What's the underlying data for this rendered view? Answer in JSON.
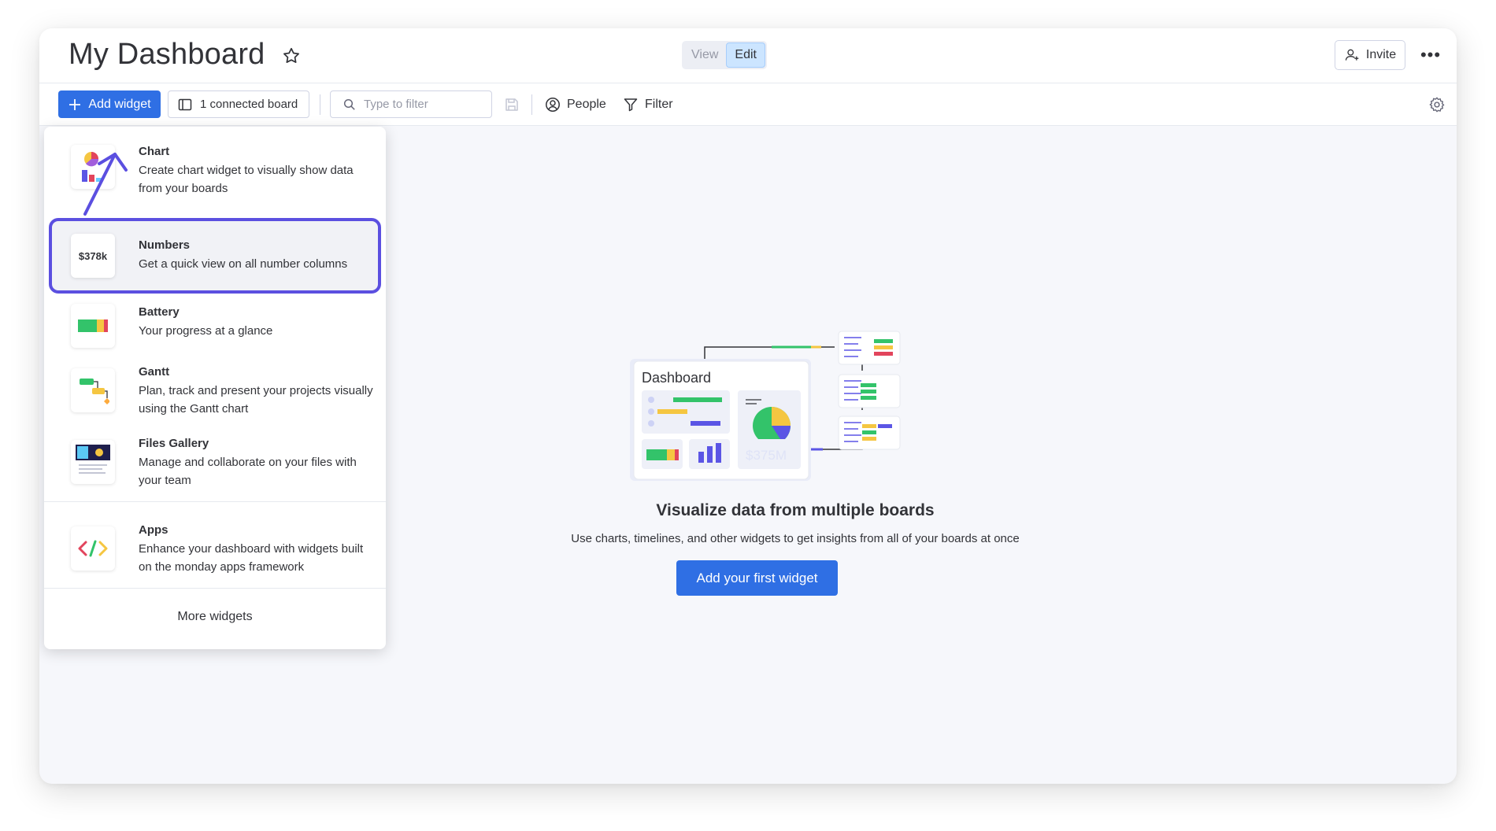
{
  "header": {
    "title": "My Dashboard",
    "mode": {
      "view_label": "View",
      "edit_label": "Edit",
      "active": "Edit"
    },
    "invite_label": "Invite",
    "more_label": "•••"
  },
  "toolbar": {
    "add_widget_label": "Add widget",
    "connected_label": "1 connected board",
    "search_placeholder": "Type to filter",
    "people_label": "People",
    "filter_label": "Filter"
  },
  "dropdown": {
    "items": [
      {
        "name": "Chart",
        "desc": "Create chart widget to visually show data from your boards",
        "icon": "chart-icon"
      },
      {
        "name": "Numbers",
        "desc": "Get a quick view on all number columns",
        "icon": "numbers-icon",
        "thumb_text": "$378k",
        "highlighted": true
      },
      {
        "name": "Battery",
        "desc": "Your progress at a glance",
        "icon": "battery-icon"
      },
      {
        "name": "Gantt",
        "desc": "Plan, track and present your projects visually using the Gantt chart",
        "icon": "gantt-icon"
      },
      {
        "name": "Files Gallery",
        "desc": "Manage and collaborate on your files with your team",
        "icon": "files-gallery-icon"
      },
      {
        "name": "Apps",
        "desc": "Enhance your dashboard with widgets built on the monday apps framework",
        "icon": "code-icon"
      }
    ],
    "more_label": "More widgets"
  },
  "empty_state": {
    "illustration_title": "Dashboard",
    "illustration_number": "$375M",
    "title": "Visualize data from multiple boards",
    "subtitle": "Use charts, timelines, and other widgets to get insights from all of your boards at once",
    "cta_label": "Add your first widget"
  },
  "colors": {
    "primary": "#2f6fe4",
    "highlight_border": "#5b4fe0",
    "green": "#33c36a",
    "yellow": "#f5c641",
    "red": "#e2445c",
    "purple": "#5b55e5"
  }
}
